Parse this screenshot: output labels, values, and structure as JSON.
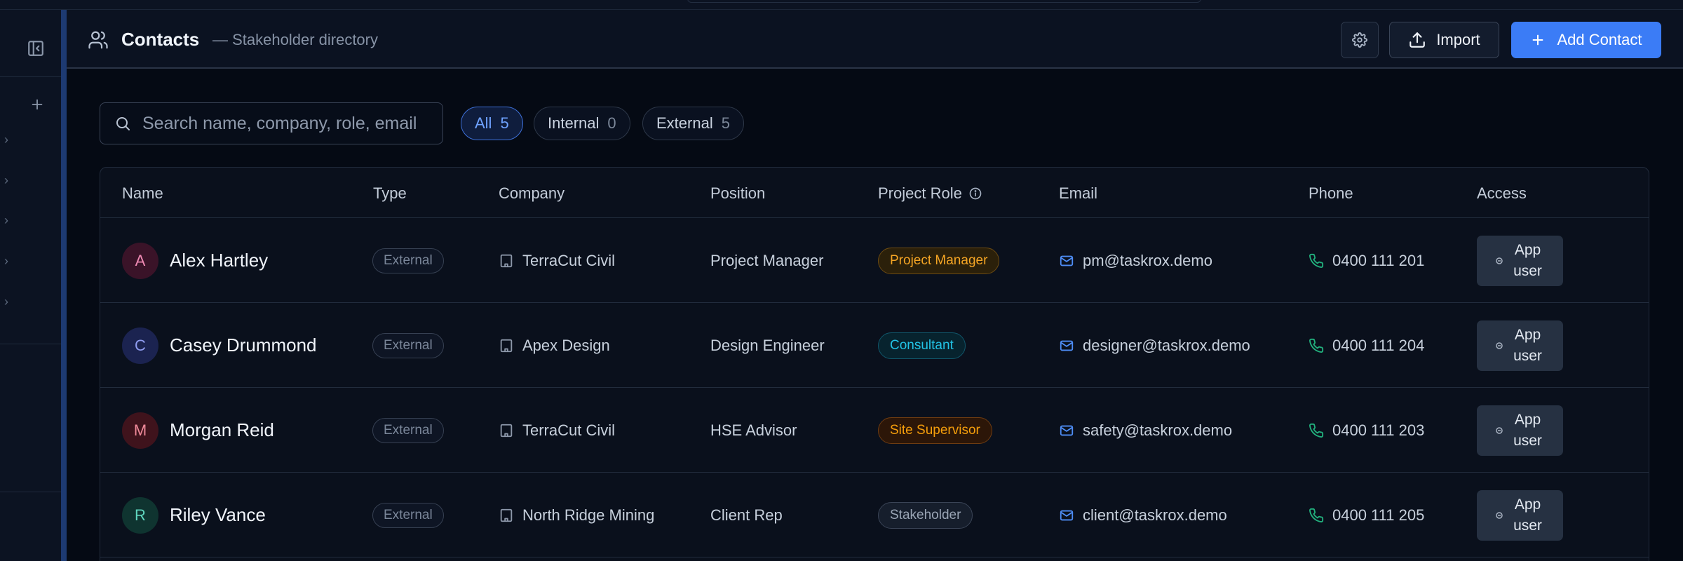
{
  "header": {
    "title": "Contacts",
    "subtitle": "— Stakeholder directory",
    "import_label": "Import",
    "add_label": "Add Contact"
  },
  "search": {
    "placeholder": "Search name, company, role, email"
  },
  "filters": [
    {
      "label": "All",
      "count": "5",
      "active": true
    },
    {
      "label": "Internal",
      "count": "0",
      "active": false
    },
    {
      "label": "External",
      "count": "5",
      "active": false
    }
  ],
  "columns": {
    "name": "Name",
    "type": "Type",
    "company": "Company",
    "position": "Position",
    "project_role": "Project Role",
    "email": "Email",
    "phone": "Phone",
    "access": "Access"
  },
  "rows": [
    {
      "initial": "A",
      "name": "Alex Hartley",
      "type": "External",
      "company": "TerraCut Civil",
      "position": "Project Manager",
      "role": "Project Manager",
      "email": "pm@taskrox.demo",
      "phone": "0400 111 201",
      "access": "App user"
    },
    {
      "initial": "C",
      "name": "Casey Drummond",
      "type": "External",
      "company": "Apex Design",
      "position": "Design Engineer",
      "role": "Consultant",
      "email": "designer@taskrox.demo",
      "phone": "0400 111 204",
      "access": "App user"
    },
    {
      "initial": "M",
      "name": "Morgan Reid",
      "type": "External",
      "company": "TerraCut Civil",
      "position": "HSE Advisor",
      "role": "Site Supervisor",
      "email": "safety@taskrox.demo",
      "phone": "0400 111 203",
      "access": "App user"
    },
    {
      "initial": "R",
      "name": "Riley Vance",
      "type": "External",
      "company": "North Ridge Mining",
      "position": "Client Rep",
      "role": "Stakeholder",
      "email": "client@taskrox.demo",
      "phone": "0400 111 205",
      "access": "App user"
    }
  ],
  "colors": {
    "accent": "#3b7cf6",
    "role_project_manager": "#f5a524",
    "role_consultant": "#22c3e6",
    "role_site_supervisor": "#f59e0b",
    "role_stakeholder": "#9aa5b5"
  },
  "icons": {
    "collapse": "sidebar-collapse-icon",
    "contacts": "users-icon",
    "settings": "gear-icon",
    "import": "upload-icon",
    "add": "plus-icon",
    "search": "search-icon",
    "company": "building-icon",
    "email": "mail-icon",
    "phone": "phone-icon",
    "info": "info-icon"
  }
}
